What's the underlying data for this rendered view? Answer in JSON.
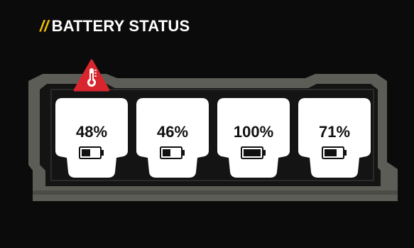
{
  "header": {
    "slashes": "//",
    "title": "BATTERY STATUS"
  },
  "colors": {
    "accent": "#f2c200",
    "background": "#0b0b0b",
    "dock": "#5d5d57",
    "warning": "#d9262e",
    "pack": "#ffffff"
  },
  "warning_icon": "thermometer-warning-icon",
  "batteries": [
    {
      "label": "48%",
      "level": 0.48
    },
    {
      "label": "46%",
      "level": 0.46
    },
    {
      "label": "100%",
      "level": 1.0
    },
    {
      "label": "71%",
      "level": 0.71
    }
  ]
}
